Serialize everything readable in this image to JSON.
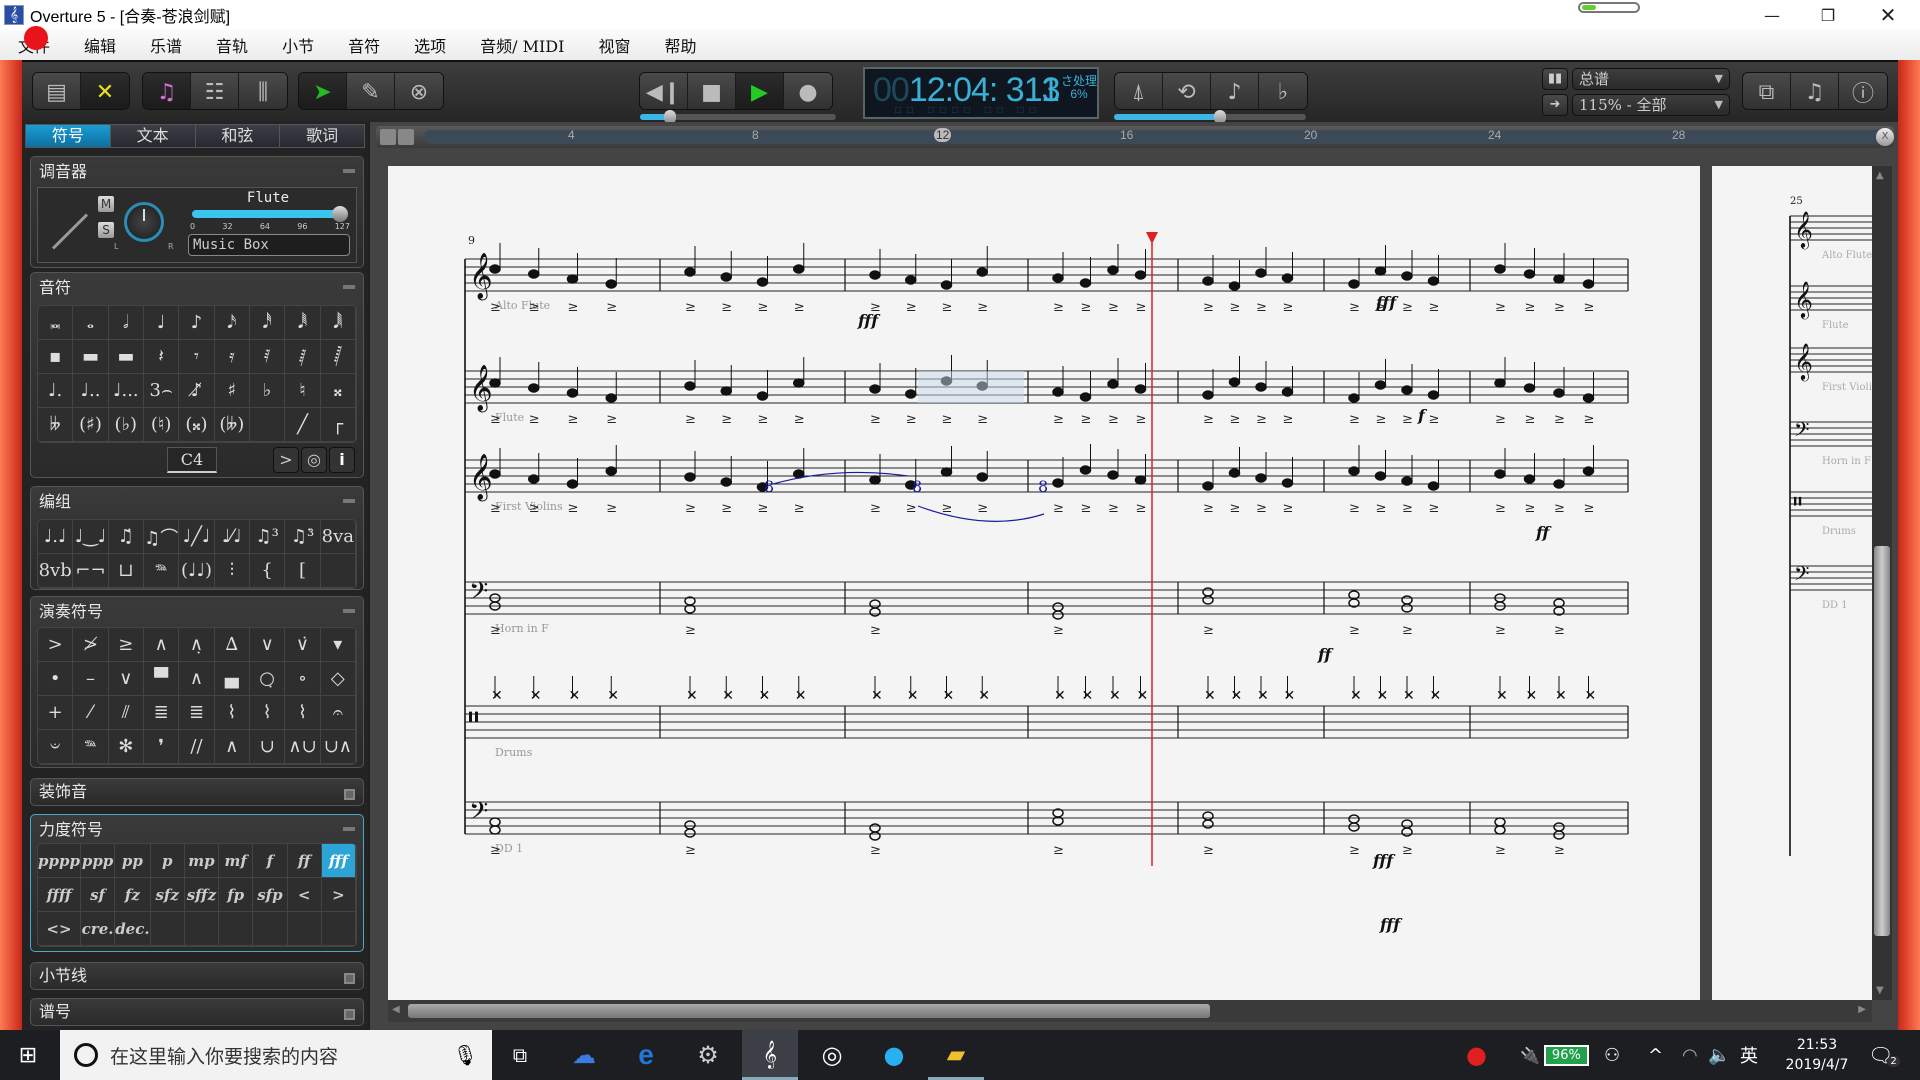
{
  "window": {
    "title": "Overture 5 - [合奏-苍浪剑赋]",
    "minimize": "—",
    "restore": "❐",
    "close": "✕"
  },
  "menu": [
    "文件",
    "编辑",
    "乐谱",
    "音轨",
    "小节",
    "音符",
    "选项",
    "音频/ MIDI",
    "视窗",
    "帮助"
  ],
  "toolbar": {
    "left_icons": [
      "drawer-icon",
      "tools-icon",
      "note-icon",
      "list-icon",
      "mixer-icon",
      "select-arrow-icon",
      "pencil-icon",
      "erase-icon"
    ],
    "transport": [
      "rewind-icon",
      "stop-icon",
      "play-icon",
      "record-icon"
    ],
    "time_display": {
      "hours": "00",
      "time": "12:04: 313",
      "beat": "1",
      "processing_label": "さ处理",
      "processing_value": "6%",
      "labels": "□□ □□□□ □□ □□"
    },
    "right_icons": [
      "metronome-icon",
      "loop-icon",
      "quantize-note-icon",
      "key-signature-icon"
    ],
    "tempo_slider": 0.55,
    "transport_slider": 0.15,
    "view_dropdown": "总谱",
    "zoom_dropdown": "115% - 全部",
    "end_icons": [
      "pages-icon",
      "score-icon",
      "info-icon"
    ],
    "colors": {
      "accent": "#3cb6e6",
      "play": "#22cc22",
      "select": "#22bb22",
      "note": "#d070d0",
      "tools": "#e8e020"
    }
  },
  "panel": {
    "tabs": [
      "符号",
      "文本",
      "和弦",
      "歌词"
    ],
    "active_tab": 0,
    "mixer": {
      "title": "调音器",
      "instrument": "Flute",
      "mute": "M",
      "solo": "S",
      "pan_l": "L",
      "pan_r": "R",
      "volume": 127,
      "scale": [
        "0",
        "32",
        "64",
        "96",
        "127"
      ],
      "patch": "Music Box"
    },
    "notes": {
      "title": "音符",
      "row1": [
        "𝅜",
        "𝅝",
        "𝅗𝅥",
        "♩",
        "♪",
        "𝅘𝅥𝅯",
        "𝅘𝅥𝅰",
        "𝅘𝅥𝅱",
        "𝅘𝅥𝅲"
      ],
      "row2": [
        "▪",
        "▬",
        "▬",
        "𝄽",
        "𝄾",
        "𝄿",
        "𝅀",
        "𝅁",
        "𝅂"
      ],
      "row3": [
        "♩.",
        "♩..",
        "♩...",
        "3⌢",
        "♪̸",
        "♯",
        "♭",
        "♮",
        "𝄪"
      ],
      "row4": [
        "𝄫",
        "(♯)",
        "(♭)",
        "(♮)",
        "(𝄪)",
        "(𝄫)",
        "",
        "╱",
        "┌"
      ],
      "pitch": "C4",
      "buttons": [
        ">",
        "◎",
        "i"
      ]
    },
    "grouping": {
      "title": "编组",
      "row1": [
        "♩.♩",
        "♩‿♩",
        "♫̇",
        "♫⌒",
        "♩╱♩",
        "♩⁄♩",
        "♫³",
        "♫³̇",
        "8va"
      ],
      "row2": [
        "8vb",
        "⌐¬",
        "⊔",
        "𝆮",
        "(♩♩)",
        "⫶",
        "{",
        "[",
        ""
      ]
    },
    "articulations": {
      "title": "演奏符号",
      "row1": [
        ">",
        "≯",
        "≥",
        "∧",
        "∧̣",
        "∆",
        "∨",
        "∨̇",
        "▾"
      ],
      "row2": [
        "•",
        "–",
        "∨",
        "▀",
        "∧",
        "▄",
        "○̣",
        "∘",
        "◇"
      ],
      "row3": [
        "+",
        "⁄",
        "⫽",
        "≣",
        "≣",
        "⌇",
        "⌇",
        "⌇",
        "𝄐"
      ],
      "row4": [
        "𝄑",
        "𝆮",
        "✻",
        "❜",
        "//",
        "∧",
        "∪",
        "∧∪",
        "∪∧"
      ]
    },
    "ornaments": {
      "title": "装饰音"
    },
    "dynamics": {
      "title": "力度符号",
      "row1": [
        "pppp",
        "ppp",
        "pp",
        "p",
        "mp",
        "mf",
        "f",
        "ff",
        "fff"
      ],
      "row2": [
        "ffff",
        "sf",
        "fz",
        "sfz",
        "sffz",
        "fp",
        "sfp",
        "<",
        ">"
      ],
      "row3": [
        "<>",
        "cre.",
        "dec."
      ],
      "selected": "fff"
    },
    "barlines": {
      "title": "小节线"
    },
    "clefs": {
      "title": "谱号"
    }
  },
  "ruler": {
    "marks": [
      "4",
      "8",
      "12",
      "16",
      "20",
      "24",
      "28"
    ],
    "current_measure": "12",
    "end_button": "X"
  },
  "score": {
    "system_start_measure": "9",
    "next_system_measure": "25",
    "staves": [
      {
        "name": "Alto Flute",
        "clef": "treble"
      },
      {
        "name": "Flute",
        "clef": "treble"
      },
      {
        "name": "First Violins",
        "clef": "treble"
      },
      {
        "name": "Horn in F",
        "clef": "bass"
      },
      {
        "name": "Drums",
        "clef": "percussion"
      },
      {
        "name": "DD 1",
        "clef": "bass"
      }
    ],
    "dynamics": [
      "fff",
      "fff",
      "f",
      "ff",
      "ff",
      "fff",
      "fff"
    ],
    "playhead_color": "#e02020",
    "selection_color": "#1a1aa0"
  },
  "taskbar": {
    "search_placeholder": "在这里输入你要搜索的内容",
    "apps": [
      "baidu-netdisk-icon",
      "edge-icon",
      "media-player-icon",
      "overture-icon",
      "music-icon",
      "meitu-icon",
      "file-explorer-icon"
    ],
    "battery": "96%",
    "ime": "英",
    "time": "21:53",
    "date": "2019/4/7",
    "notifications": "2"
  }
}
